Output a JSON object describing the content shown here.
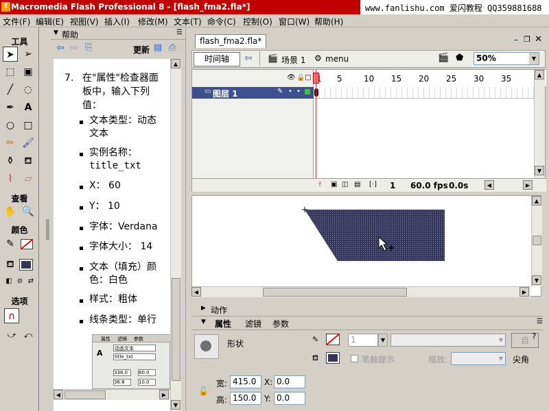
{
  "titlebar": {
    "title": "Macromedia Flash Professional 8 - [flash_fma2.fla*]",
    "site": "www.fanlishu.com 爱闪教程 QQ359881688"
  },
  "menu": [
    "文件(F)",
    "编辑(E)",
    "视图(V)",
    "插入(I)",
    "修改(M)",
    "文本(T)",
    "命令(C)",
    "控制(O)",
    "窗口(W)",
    "帮助(H)"
  ],
  "tools": {
    "title": "工具",
    "view_label": "查看",
    "colors_label": "颜色",
    "options_label": "选项"
  },
  "help": {
    "title": "帮助",
    "update": "更新",
    "step_num": "7.",
    "step_lines": [
      "在\"属性\"检查器面",
      "板中，输入下列",
      "值："
    ],
    "items": [
      [
        "文本类型：动态",
        "文本"
      ],
      [
        "实例名称：",
        "title_txt"
      ],
      [
        "X：  60"
      ],
      [
        "Y：  10"
      ],
      [
        "字体：Verdana"
      ],
      [
        "字体大小：  14"
      ],
      [
        "文本（填充）颜",
        "色：白色"
      ],
      [
        "样式：粗体"
      ],
      [
        "线条类型：单行"
      ]
    ],
    "thumb": {
      "tabs": [
        "属性",
        "滤镜",
        "参数"
      ],
      "type": "动态文本",
      "name": "title_txt",
      "w": "338.0",
      "x": "60.0",
      "h": "36.8",
      "y": "10.0"
    }
  },
  "document": {
    "tab": "flash_fma2.fla*",
    "timeline_button": "时间轴",
    "scene": "场景 1",
    "symbol": "menu",
    "zoom": "50%"
  },
  "timeline": {
    "layer": "图层 1",
    "ruler": [
      "1",
      "5",
      "10",
      "15",
      "20",
      "25",
      "30",
      "35"
    ],
    "frame": "1",
    "fps": "60.0 fps",
    "time": "0.0s"
  },
  "panels": {
    "actions": "动作",
    "tabs": [
      "属性",
      "滤镜",
      "参数"
    ],
    "shape_label": "形状",
    "stroke_width": "1",
    "hint_label": "笔触提示",
    "scale_label": "缩放:",
    "cap_label": "尖角",
    "w_label": "宽:",
    "w_value": "415.0",
    "x_label": "X:",
    "x_value": "0.0",
    "h_label": "高:",
    "h_value": "150.0",
    "y_label": "Y:",
    "y_value": "0.0",
    "custom_label": "自"
  },
  "colors": {
    "title_red": "#c00000",
    "layer_blue": "#3d4f8c",
    "shape_fill": "#35365a"
  }
}
